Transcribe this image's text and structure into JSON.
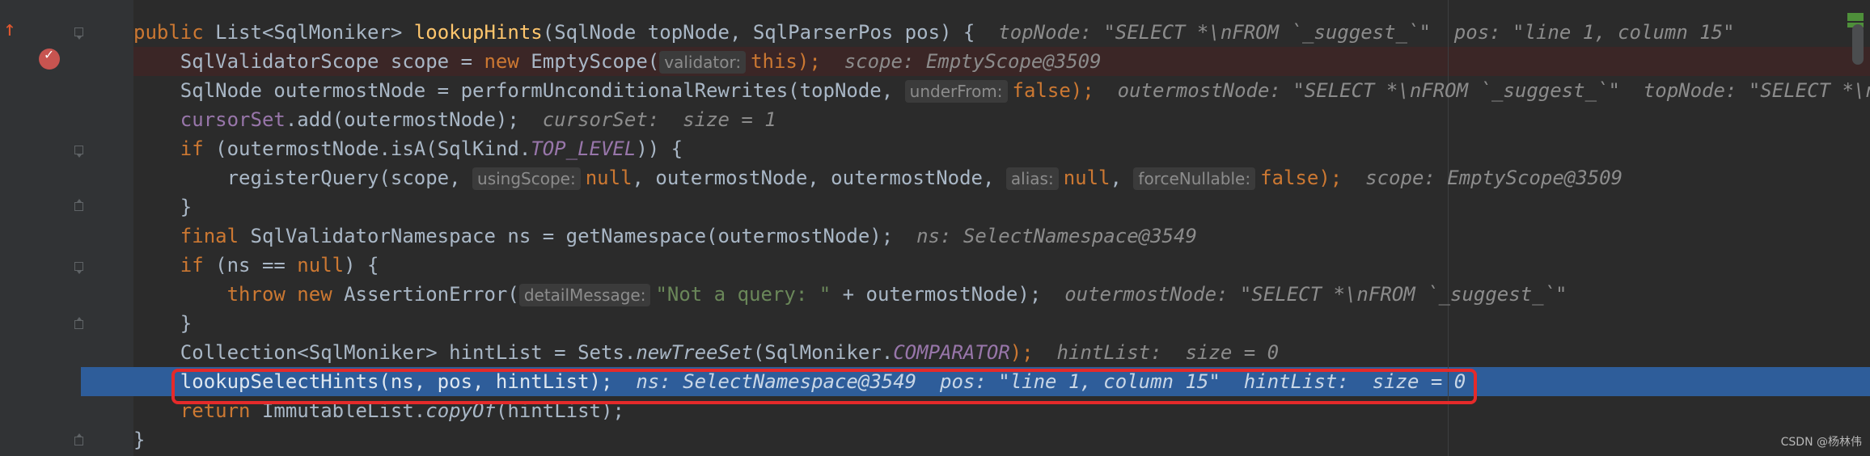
{
  "editor": {
    "lines": [
      {
        "code_prefix": "public ",
        "type": "List<SqlMoniker> ",
        "method": "lookupHints",
        "rest": "(SqlNode topNode, SqlParserPos pos) {",
        "debug": "topNode: \"SELECT *\\nFROM `_suggest_`\"  pos: \"line 1, column 15\""
      },
      {
        "text": "SqlValidatorScope scope = ",
        "kw": "new",
        "call": " EmptyScope(",
        "hint": "validator:",
        "kw2": "this",
        "end": ");",
        "debug": "scope: EmptyScope@3509"
      },
      {
        "text": "SqlNode outermostNode = performUnconditionalRewrites(topNode, ",
        "hint": "underFrom:",
        "kw": "false",
        "end": ");",
        "debug": "outermostNode: \"SELECT *\\nFROM `_suggest_`\"  topNode: \"SELECT *\\nFROM"
      },
      {
        "field": "cursorSet",
        "text": ".add(outermostNode);",
        "debug": "cursorSet:  size = 1"
      },
      {
        "kw": "if",
        "text": " (outermostNode.isA(SqlKind.",
        "const": "TOP_LEVEL",
        "end": ")) {"
      },
      {
        "text": "registerQuery(scope, ",
        "hint1": "usingScope:",
        "kw1": "null",
        "mid": ", outermostNode, outermostNode, ",
        "hint2": "alias:",
        "kw2": "null",
        "sep": ", ",
        "hint3": "forceNullable:",
        "kw3": "false",
        "end": ");",
        "debug": "scope: EmptyScope@3509"
      },
      {
        "text": "}"
      },
      {
        "kw": "final",
        "text": " SqlValidatorNamespace ns = getNamespace(outermostNode);",
        "debug": "ns: SelectNamespace@3549"
      },
      {
        "kw": "if",
        "text": " (ns == ",
        "kw2": "null",
        "end": ") {"
      },
      {
        "kw": "throw new",
        "text": " AssertionError(",
        "hint": "detailMessage:",
        "str": "\"Not a query: \"",
        "end": " + outermostNode);",
        "debug": "outermostNode: \"SELECT *\\nFROM `_suggest_`\""
      },
      {
        "text": "}"
      },
      {
        "text": "Collection<SqlMoniker> hintList = Sets.",
        "static": "newTreeSet",
        "mid": "(SqlMoniker.",
        "const": "COMPARATOR",
        "end": ");",
        "debug": "hintList:  size = 0"
      },
      {
        "text": "lookupSelectHints(ns, pos, hintList);",
        "debug": "ns: SelectNamespace@3549  pos: \"line 1, column 15\"  hintList:  size = 0"
      },
      {
        "kw": "return",
        "text": " ImmutableList.",
        "static": "copyOf",
        "end": "(hintList);"
      },
      {
        "text": "}"
      }
    ]
  },
  "watermark": "CSDN @杨林伟",
  "colors": {
    "background": "#2b2b2b",
    "keyword": "#cc7832",
    "method": "#ffc66d",
    "string": "#6a8759",
    "constant": "#9876aa",
    "execution_line": "#2e5d9a",
    "highlight_border": "#e52a2a"
  }
}
